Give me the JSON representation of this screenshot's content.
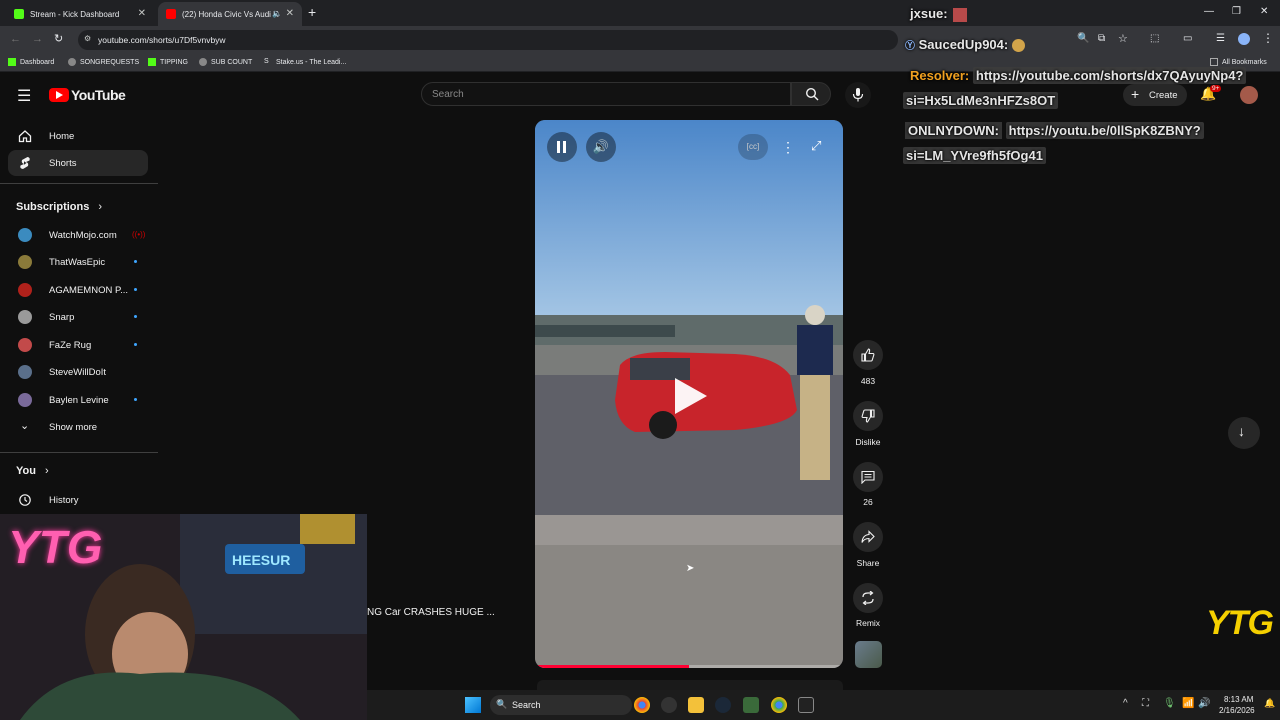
{
  "browser": {
    "tabs": [
      {
        "title": "Stream - Kick Dashboard",
        "favicon": "kick-icon",
        "active": false
      },
      {
        "title": "(22) Honda Civic Vs Audi R",
        "favicon": "youtube-icon",
        "active": true
      }
    ],
    "url": "youtube.com/shorts/u7Df5vnvbyw",
    "bookmarks": [
      "Dashboard",
      "SONGREQUESTS",
      "TIPPING",
      "SUB COUNT",
      "Stake.us - The Leadi..."
    ],
    "all_bookmarks": "All Bookmarks"
  },
  "youtube": {
    "logo_text": "YouTube",
    "search_placeholder": "Search",
    "create_label": "Create",
    "notif_badge": "9+",
    "sidebar": {
      "main": [
        {
          "label": "Home",
          "icon": "home-icon"
        },
        {
          "label": "Shorts",
          "icon": "shorts-icon",
          "active": true
        }
      ],
      "subscriptions_label": "Subscriptions",
      "subscriptions": [
        {
          "label": "WatchMojo.com",
          "color": "#3b8bbf",
          "live": true
        },
        {
          "label": "ThatWasEpic",
          "color": "#8a7a3a",
          "live": false
        },
        {
          "label": "AGAMEMNON P...",
          "color": "#b0211b",
          "live": false
        },
        {
          "label": "Snarp",
          "color": "#9a9a9a",
          "live": false
        },
        {
          "label": "FaZe Rug",
          "color": "#c24a4a",
          "live": false
        },
        {
          "label": "SteveWillDoIt",
          "color": "#5a6f8a",
          "live": false
        },
        {
          "label": "Baylen Levine",
          "color": "#7a6a9a",
          "live": false
        }
      ],
      "show_more": "Show more",
      "you_label": "You",
      "history_label": "History"
    },
    "video_caption": "NG Car CRASHES HUGE ...",
    "progress": 0.5,
    "actions": {
      "likes": "483",
      "dislike": "Dislike",
      "comments": "26",
      "share": "Share",
      "remix": "Remix"
    }
  },
  "chat": [
    {
      "user": "jxsue:",
      "user_color": "#e8e8e8",
      "text": ""
    },
    {
      "user": "SaucedUp904:",
      "user_color": "#e8e8e8",
      "text": ""
    },
    {
      "user": "Resolver:",
      "user_color": "#f0a020",
      "text": "https://youtube.com/shorts/dx7QAyuyNp4?",
      "text2": "si=Hx5LdMe3nHFZs8OT"
    },
    {
      "user": "ONLNYDOWN:",
      "user_color": "#e8e8e8",
      "text": "https://youtu.be/0llSpK8ZBNY?",
      "text2": "si=LM_YVre9fh5fOg41"
    }
  ],
  "overlay_logo": "YTG",
  "webcam_neon": "YTG",
  "webcam_sign": "HEESUR",
  "taskbar": {
    "search_label": "Search",
    "time": "8:13 AM",
    "date": "2/16/2026"
  }
}
